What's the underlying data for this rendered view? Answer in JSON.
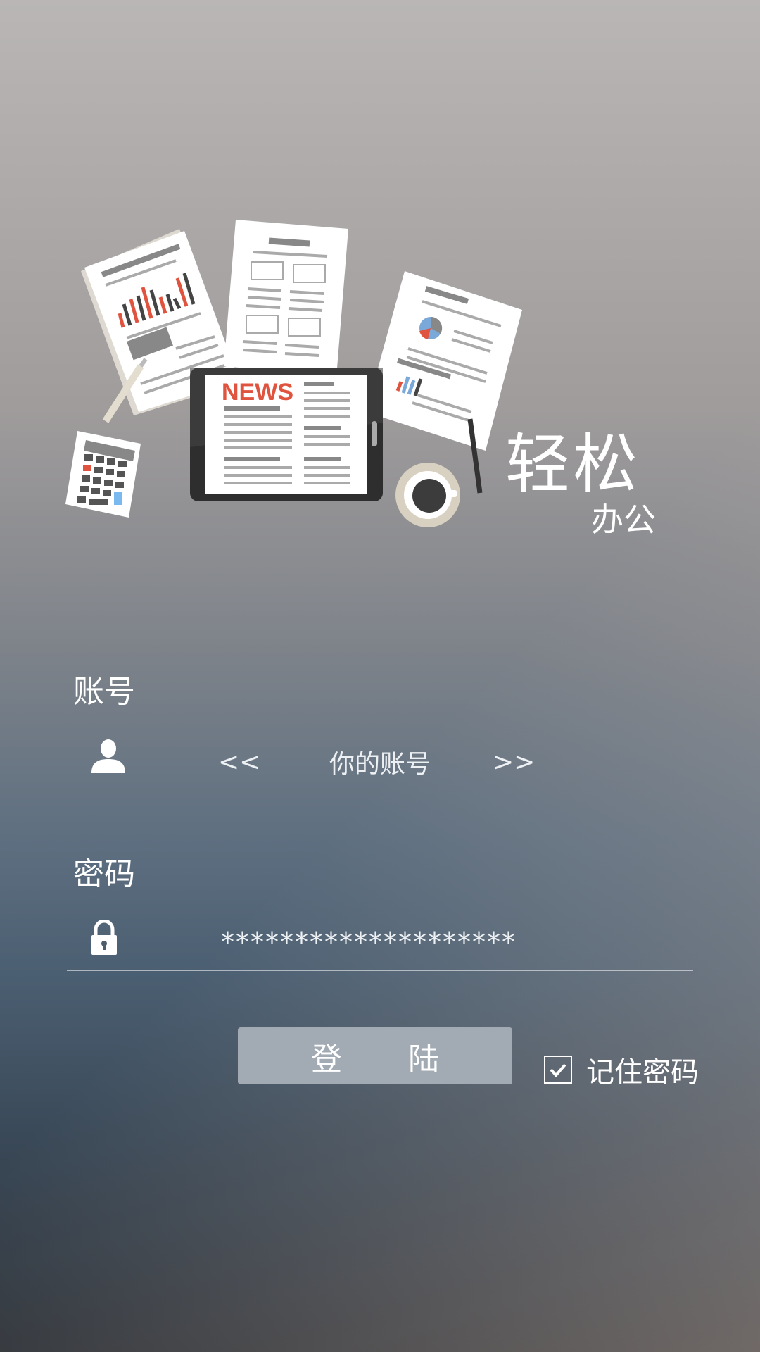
{
  "slogan": {
    "main": "轻松",
    "sub": "办公"
  },
  "illustration": {
    "news_label": "NEWS"
  },
  "form": {
    "account": {
      "label": "账号",
      "icon": "user-icon",
      "left_arrow": "<<",
      "placeholder": "你的账号",
      "right_arrow": ">>"
    },
    "password": {
      "label": "密码",
      "icon": "lock-icon",
      "value": "********************"
    },
    "login_button": "登 陆",
    "remember": {
      "label": "记住密码",
      "checked": true
    }
  },
  "colors": {
    "news_red": "#e0533f",
    "button_bg": "#a2abb4"
  }
}
